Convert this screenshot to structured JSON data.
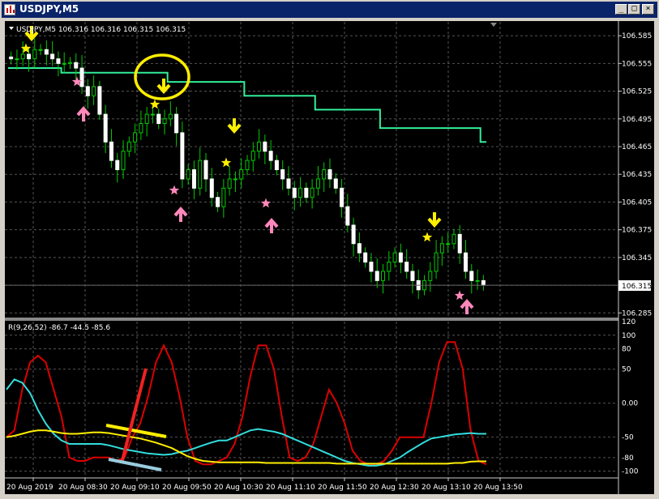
{
  "window": {
    "title": "USDJPY,M5",
    "controls": [
      "minimize",
      "maximize",
      "close"
    ]
  },
  "main_panel": {
    "header": "USDJPY,M5  106.316 106.316 106.315 106.315",
    "price_labels": [
      "106.585",
      "106.555",
      "106.525",
      "106.495",
      "106.465",
      "106.435",
      "106.405",
      "106.375",
      "106.345",
      "106.315",
      "106.285"
    ],
    "current_price_label": "106.315"
  },
  "sub_panel": {
    "header": "R(9,26,52) -86.7 -44.5 -85.6",
    "level_labels": [
      "120",
      "100",
      "80",
      "50",
      "0.00",
      "-50",
      "-80",
      "-100"
    ]
  },
  "time_labels": [
    "20 Aug 2019",
    "20 Aug 08:30",
    "20 Aug 09:10",
    "20 Aug 09:50",
    "20 Aug 10:30",
    "20 Aug 11:10",
    "20 Aug 11:50",
    "20 Aug 12:30",
    "20 Aug 13:10",
    "20 Aug 13:50"
  ],
  "colors": {
    "background": "#000000",
    "candle_up": "#ffffff",
    "candle_wick": "#00cc00",
    "step_line": "#33ee99",
    "rsi_red": "#dd0000",
    "rsi_cyan": "#33dddd",
    "rsi_yellow": "#ffee00",
    "arrow_down": "#ffee00",
    "arrow_up": "#ff88bb",
    "annotation_circle": "#ffee00"
  },
  "chart_data": [
    {
      "type": "candlestick",
      "symbol": "USDJPY",
      "timeframe": "M5",
      "ylim": [
        106.28,
        106.6
      ],
      "closes": [
        106.56,
        106.56,
        106.565,
        106.56,
        106.57,
        106.57,
        106.565,
        106.56,
        106.555,
        106.555,
        106.556,
        106.55,
        106.53,
        106.52,
        106.53,
        106.5,
        106.47,
        106.45,
        106.44,
        106.46,
        106.47,
        106.48,
        106.49,
        106.5,
        106.5,
        106.49,
        106.495,
        106.5,
        106.48,
        106.43,
        106.44,
        106.42,
        106.45,
        106.43,
        106.41,
        106.4,
        106.42,
        106.43,
        106.43,
        106.44,
        106.45,
        106.46,
        106.47,
        106.46,
        106.45,
        106.44,
        106.43,
        106.42,
        106.41,
        106.42,
        106.41,
        106.42,
        106.43,
        106.44,
        106.43,
        106.42,
        106.4,
        106.38,
        106.36,
        106.35,
        106.34,
        106.33,
        106.32,
        106.33,
        106.34,
        106.35,
        106.34,
        106.33,
        106.32,
        106.31,
        106.32,
        106.33,
        106.35,
        106.36,
        106.36,
        106.37,
        106.35,
        106.33,
        106.32,
        106.32,
        106.315
      ],
      "step_line": [
        106.55,
        106.55,
        106.55,
        106.55,
        106.55,
        106.55,
        106.55,
        106.55,
        106.55,
        106.545,
        106.545,
        106.545,
        106.545,
        106.545,
        106.545,
        106.545,
        106.545,
        106.545,
        106.545,
        106.545,
        106.545,
        106.545,
        106.545,
        106.545,
        106.545,
        106.545,
        106.545,
        106.535,
        106.535,
        106.535,
        106.535,
        106.535,
        106.535,
        106.535,
        106.535,
        106.535,
        106.535,
        106.535,
        106.535,
        106.535,
        106.52,
        106.52,
        106.52,
        106.52,
        106.52,
        106.52,
        106.52,
        106.52,
        106.52,
        106.52,
        106.52,
        106.52,
        106.505,
        106.505,
        106.505,
        106.505,
        106.505,
        106.505,
        106.505,
        106.505,
        106.505,
        106.505,
        106.505,
        106.485,
        106.485,
        106.485,
        106.485,
        106.485,
        106.485,
        106.485,
        106.485,
        106.485,
        106.485,
        106.485,
        106.485,
        106.485,
        106.485,
        106.485,
        106.485,
        106.485,
        106.47
      ],
      "current_price": 106.315
    },
    {
      "type": "line",
      "name": "R(9,26,52)",
      "ylim": [
        -110,
        120
      ],
      "levels": [
        100,
        80,
        50,
        0,
        -50,
        -80,
        -100
      ],
      "series": [
        {
          "color": "red",
          "values": [
            -50,
            -40,
            20,
            60,
            70,
            60,
            20,
            -20,
            -80,
            -85,
            -85,
            -80,
            -80,
            -80,
            -85,
            -80,
            -50,
            -30,
            10,
            60,
            85,
            60,
            10,
            -50,
            -85,
            -90,
            -90,
            -85,
            -80,
            -60,
            -20,
            40,
            85,
            85,
            50,
            -20,
            -80,
            -85,
            -80,
            -60,
            -20,
            20,
            0,
            -30,
            -70,
            -85,
            -90,
            -90,
            -85,
            -70,
            -50,
            -50,
            -50,
            -50,
            0,
            60,
            90,
            90,
            50,
            -40,
            -85,
            -90
          ]
        },
        {
          "color": "cyan",
          "values": [
            20,
            35,
            30,
            15,
            -10,
            -30,
            -45,
            -55,
            -60,
            -60,
            -60,
            -60,
            -60,
            -62,
            -65,
            -68,
            -70,
            -72,
            -74,
            -75,
            -76,
            -75,
            -72,
            -70,
            -66,
            -62,
            -58,
            -55,
            -55,
            -50,
            -45,
            -40,
            -38,
            -40,
            -42,
            -45,
            -50,
            -55,
            -60,
            -65,
            -70,
            -75,
            -80,
            -85,
            -88,
            -90,
            -92,
            -92,
            -90,
            -85,
            -80,
            -72,
            -65,
            -58,
            -52,
            -50,
            -48,
            -46,
            -45,
            -44,
            -45,
            -45
          ]
        },
        {
          "color": "yellow",
          "values": [
            -50,
            -48,
            -45,
            -42,
            -40,
            -40,
            -42,
            -44,
            -45,
            -45,
            -44,
            -43,
            -43,
            -44,
            -46,
            -48,
            -50,
            -52,
            -55,
            -58,
            -62,
            -66,
            -72,
            -78,
            -82,
            -85,
            -86,
            -87,
            -87,
            -87,
            -87,
            -87,
            -87,
            -88,
            -88,
            -88,
            -88,
            -88,
            -88,
            -88,
            -88,
            -88,
            -89,
            -89,
            -89,
            -89,
            -89,
            -89,
            -89,
            -89,
            -89,
            -89,
            -89,
            -89,
            -89,
            -89,
            -89,
            -88,
            -88,
            -86,
            -85.6,
            -85.6
          ]
        }
      ]
    }
  ]
}
